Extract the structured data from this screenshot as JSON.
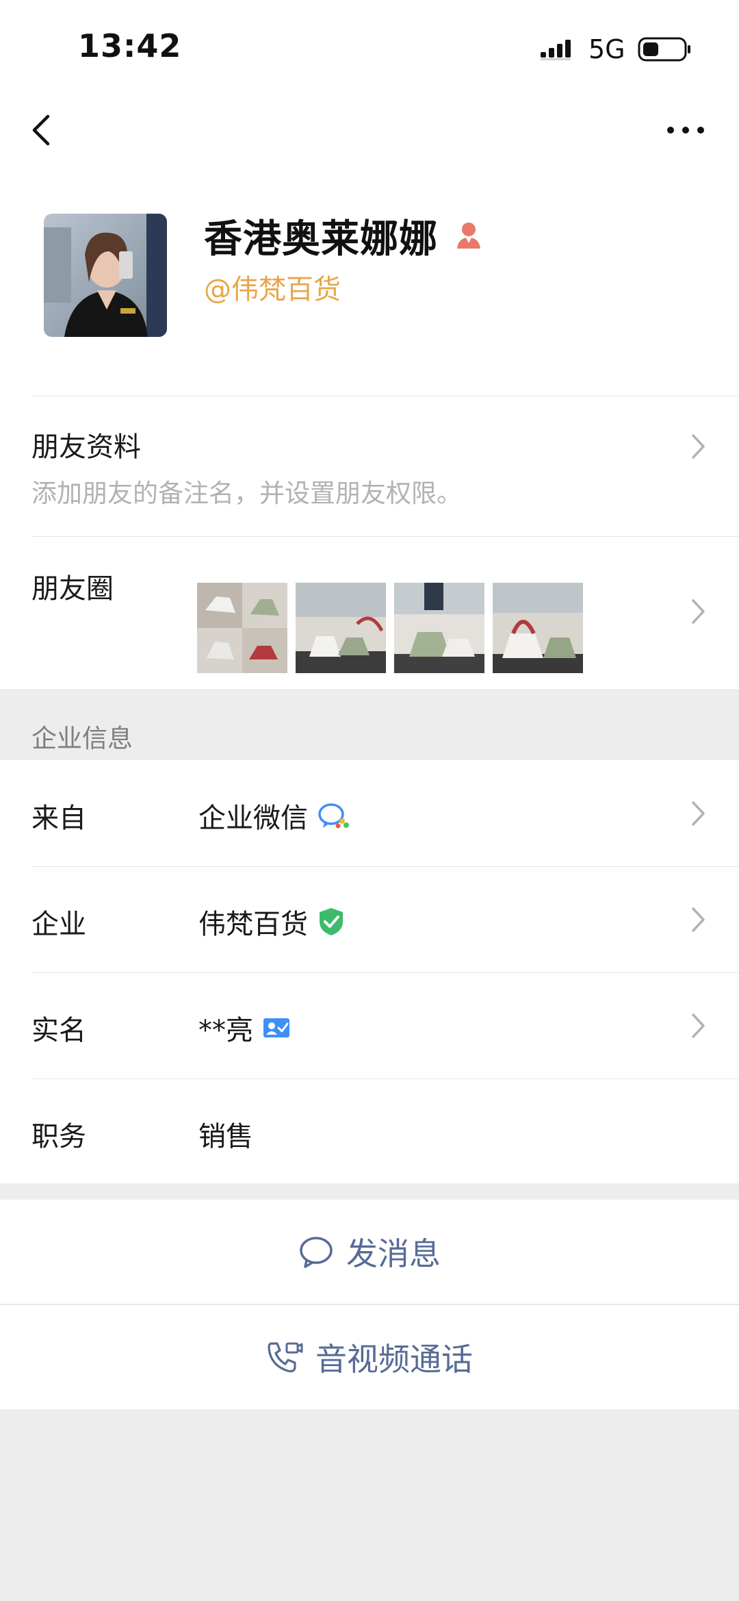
{
  "status_bar": {
    "time": "13:42",
    "network": "5G"
  },
  "nav": {
    "back_icon": "chevron-left-icon",
    "more_icon": "more-dots-icon"
  },
  "profile": {
    "nickname": "香港奥莱娜娜",
    "gender_icon": "female-icon",
    "company_tag": "@伟梵百货"
  },
  "friend_profile": {
    "title": "朋友资料",
    "subtitle": "添加朋友的备注名，并设置朋友权限。"
  },
  "moments": {
    "label": "朋友圈",
    "thumbnail_count": 4
  },
  "enterprise": {
    "header": "企业信息",
    "rows": [
      {
        "label": "来自",
        "value": "企业微信",
        "icon": "wecom-icon",
        "has_chevron": true
      },
      {
        "label": "企业",
        "value": "伟梵百货",
        "icon": "verified-shield-icon",
        "has_chevron": true
      },
      {
        "label": "实名",
        "value": "**亮",
        "icon": "real-name-card-icon",
        "has_chevron": true
      },
      {
        "label": "职务",
        "value": "销售",
        "icon": "",
        "has_chevron": false
      }
    ]
  },
  "actions": {
    "message": "发消息",
    "call": "音视频通话"
  },
  "colors": {
    "link_blue": "#576b95",
    "company_orange": "#e8a64a",
    "verified_green": "#3dbb6a",
    "gender_pink": "#e9786b"
  }
}
